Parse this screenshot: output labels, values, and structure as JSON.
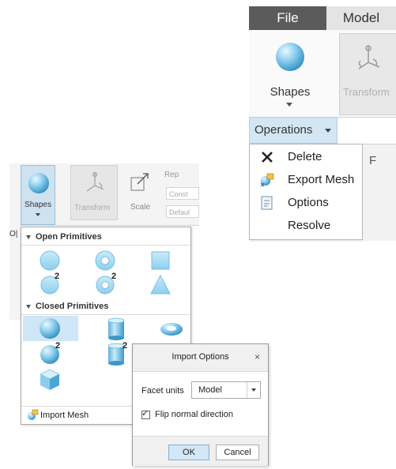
{
  "ribbon_top": {
    "tabs": [
      {
        "label": "File"
      },
      {
        "label": "Model"
      }
    ],
    "shapes_label": "Shapes",
    "transform_label": "Transform",
    "operations_label": "Operations",
    "menu_items": [
      {
        "label": "Delete",
        "icon": "delete-x-icon"
      },
      {
        "label": "Export Mesh",
        "icon": "export-mesh-icon"
      },
      {
        "label": "Options",
        "icon": "options-icon"
      },
      {
        "label": "Resolve",
        "icon": "none"
      }
    ],
    "side_strip_label": "F"
  },
  "ribbon_left": {
    "shapes_label": "Shapes",
    "transform_label": "Transform",
    "scale_label": "Scale",
    "rep_label": "Rep",
    "const_label": "Const",
    "default_label": "Defaul",
    "op_label": "O|"
  },
  "gallery": {
    "open_header": "Open Primitives",
    "closed_header": "Closed Primitives",
    "open_items": [
      {
        "icon": "disc-icon",
        "badge": ""
      },
      {
        "icon": "ring-icon",
        "badge": ""
      },
      {
        "icon": "square-plane-icon",
        "badge": ""
      },
      {
        "icon": "disc-icon",
        "badge": "2"
      },
      {
        "icon": "ring-icon",
        "badge": "2"
      },
      {
        "icon": "triangle-plane-icon",
        "badge": ""
      }
    ],
    "closed_items": [
      {
        "icon": "sphere-icon",
        "badge": "",
        "selected": true
      },
      {
        "icon": "cylinder-icon",
        "badge": ""
      },
      {
        "icon": "torus-icon",
        "badge": ""
      },
      {
        "icon": "sphere-icon",
        "badge": "2"
      },
      {
        "icon": "cylinder-icon",
        "badge": "2"
      },
      {
        "icon": "cube-icon",
        "badge": ""
      }
    ],
    "import_label": "Import Mesh"
  },
  "dialog": {
    "title": "Import Options",
    "close_glyph": "×",
    "facet_units_label": "Facet units",
    "facet_units_value": "Model",
    "flip_label": "Flip normal direction",
    "flip_checked": true,
    "ok_label": "OK",
    "cancel_label": "Cancel"
  },
  "colors": {
    "accent_blue": "#cfe2f0",
    "shape_blue": "#7fc3e8",
    "file_tab": "#5b5b5b"
  }
}
